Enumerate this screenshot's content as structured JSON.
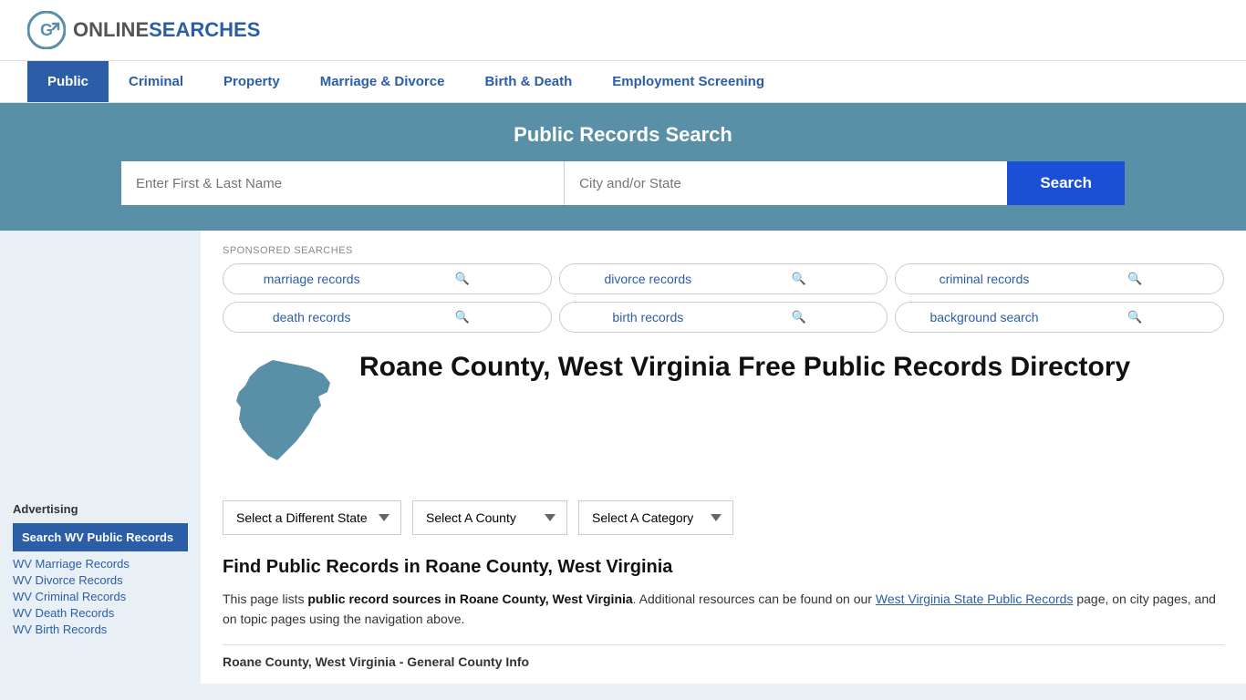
{
  "site": {
    "logo_online": "ONLINE",
    "logo_searches": "SEARCHES"
  },
  "nav": {
    "items": [
      {
        "label": "Public",
        "active": true
      },
      {
        "label": "Criminal",
        "active": false
      },
      {
        "label": "Property",
        "active": false
      },
      {
        "label": "Marriage & Divorce",
        "active": false
      },
      {
        "label": "Birth & Death",
        "active": false
      },
      {
        "label": "Employment Screening",
        "active": false
      }
    ]
  },
  "search_banner": {
    "title": "Public Records Search",
    "name_placeholder": "Enter First & Last Name",
    "location_placeholder": "City and/or State",
    "button_label": "Search"
  },
  "sponsored": {
    "label": "SPONSORED SEARCHES",
    "items": [
      "marriage records",
      "divorce records",
      "criminal records",
      "death records",
      "birth records",
      "background search"
    ]
  },
  "page": {
    "title": "Roane County, West Virginia Free Public Records Directory",
    "dropdowns": {
      "state": "Select a Different State",
      "county": "Select A County",
      "category": "Select A Category"
    },
    "find_title": "Find Public Records in Roane County, West Virginia",
    "find_desc_part1": "This page lists ",
    "find_desc_bold": "public record sources in Roane County, West Virginia",
    "find_desc_part2": ". Additional resources can be found on our ",
    "find_desc_link": "West Virginia State Public Records",
    "find_desc_part3": " page, on city pages, and on topic pages using the navigation above.",
    "county_info_heading": "Roane County, West Virginia - General County Info"
  },
  "sidebar": {
    "advertising_label": "Advertising",
    "ad_highlight": "Search WV Public Records",
    "links": [
      "WV Marriage Records",
      "WV Divorce Records",
      "WV Criminal Records",
      "WV Death Records",
      "WV Birth Records"
    ]
  }
}
